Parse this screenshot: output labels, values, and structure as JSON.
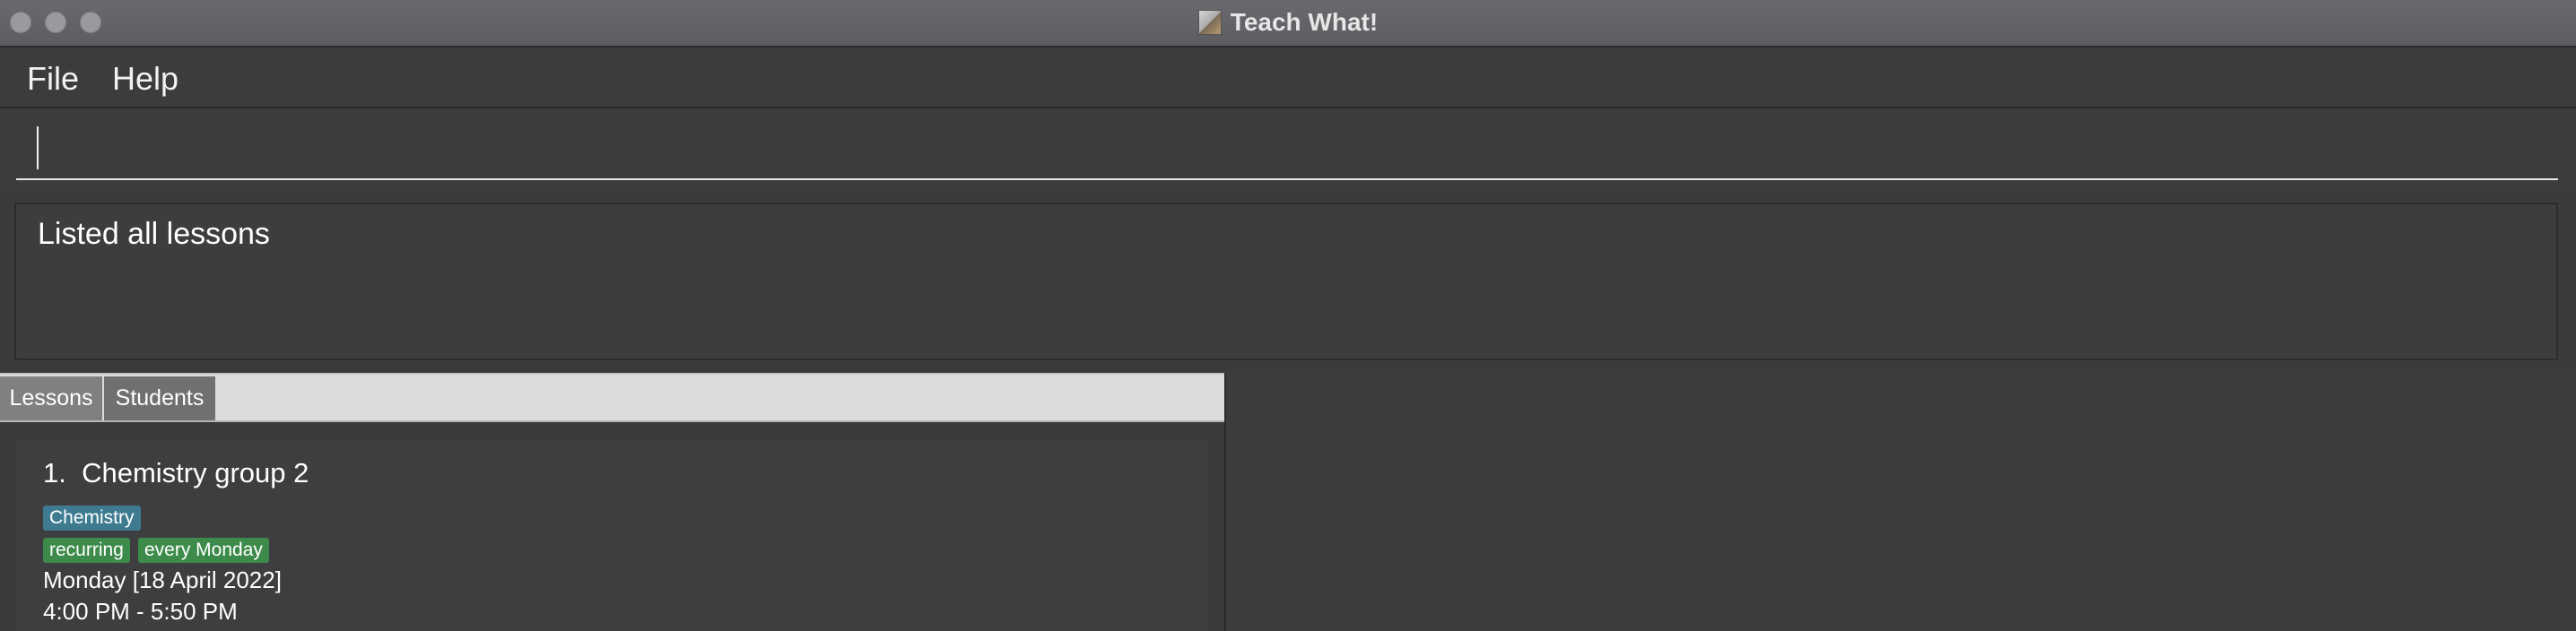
{
  "window": {
    "title": "Teach What!"
  },
  "menu": {
    "items": [
      "File",
      "Help"
    ]
  },
  "command": {
    "value": "",
    "placeholder": ""
  },
  "result": {
    "message": "Listed all lessons"
  },
  "tabs": [
    "Lessons",
    "Students"
  ],
  "lessons": [
    {
      "index": "1.",
      "name": "Chemistry group 2",
      "subject": "Chemistry",
      "tags": [
        "recurring",
        "every Monday"
      ],
      "date": "Monday [18 April 2022]",
      "time": "4:00 PM - 5:50 PM"
    }
  ],
  "colors": {
    "subject_tag": "#3e7b91",
    "recurring_tag": "#3d8b4a",
    "background": "#3b3b3d"
  },
  "icons": {
    "app": "teach-what-app-icon"
  }
}
